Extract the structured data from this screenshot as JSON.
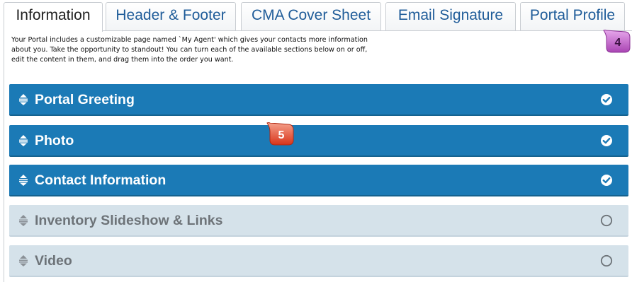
{
  "tabs": [
    {
      "label": "Information",
      "active": true
    },
    {
      "label": "Header & Footer",
      "active": false
    },
    {
      "label": "CMA Cover Sheet",
      "active": false
    },
    {
      "label": "Email Signature",
      "active": false
    },
    {
      "label": "Portal Profile",
      "active": false
    }
  ],
  "intro": {
    "line1": "Your Portal includes a customizable page named `My Agent' which gives your contacts more information",
    "line2": "about you. Take the opportunity to standout! You can turn each of the available sections below on or off,",
    "line3": "edit the content in them, and drag them into the order you want."
  },
  "sections": [
    {
      "title": "Portal Greeting",
      "enabled": true
    },
    {
      "title": "Photo",
      "enabled": true
    },
    {
      "title": "Contact Information",
      "enabled": true
    },
    {
      "title": "Inventory Slideshow & Links",
      "enabled": false
    },
    {
      "title": "Video",
      "enabled": false
    }
  ],
  "callouts": [
    {
      "number": "4",
      "color": "#c060c8",
      "text_color": "#3a1040"
    },
    {
      "number": "5",
      "color": "#e8452c",
      "text_color": "#ffffff"
    }
  ],
  "colors": {
    "section_on": "#1b7ab6",
    "section_off": "#d5e2ea",
    "tab_text": "#1f5c99"
  },
  "icons": {
    "drag_handle": "drag-handle-icon",
    "enabled": "check-circle-icon",
    "disabled": "empty-circle-icon"
  }
}
